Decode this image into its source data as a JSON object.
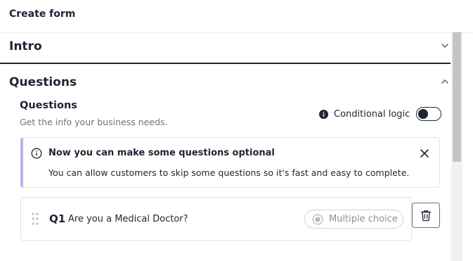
{
  "header": {
    "title": "Create form"
  },
  "sections": {
    "intro": {
      "title": "Intro",
      "expanded": false
    },
    "questions": {
      "title": "Questions",
      "expanded": true
    }
  },
  "questions_block": {
    "heading": "Questions",
    "subtitle": "Get the info your business needs.",
    "conditional_logic": {
      "label": "Conditional logic",
      "enabled": false
    }
  },
  "banner": {
    "title": "Now you can make some questions optional",
    "text": "You can allow customers to skip some questions so it's fast and easy to complete."
  },
  "question_list": [
    {
      "number": "Q1",
      "text": "Are you a Medical Doctor?",
      "type": "Multiple choice"
    }
  ],
  "colors": {
    "text": "#1d2533",
    "banner_accent": "#b9b4ec",
    "muted": "#8a8f98"
  }
}
